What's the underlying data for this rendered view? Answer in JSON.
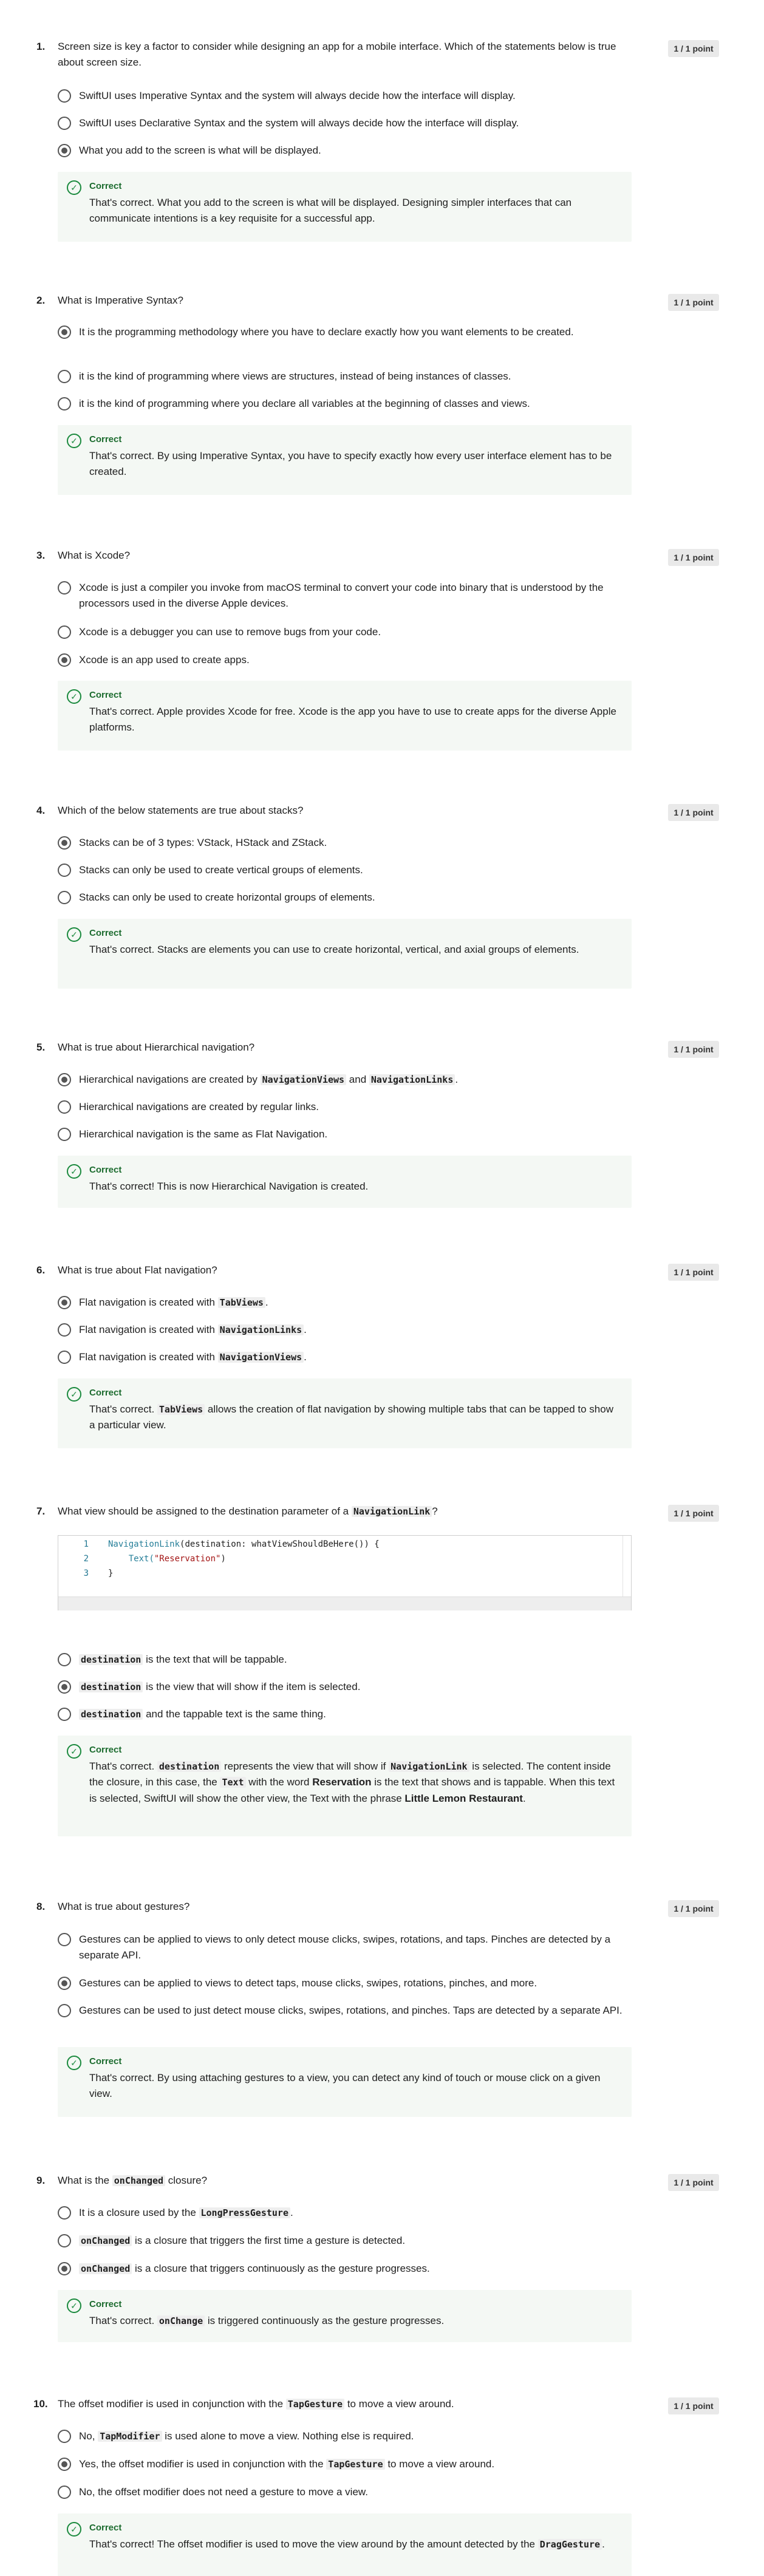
{
  "points_label": "1 / 1 point",
  "correct_label": "Correct",
  "questions": [
    {
      "number": "1.",
      "text": "Screen size is key a factor to consider while designing an app for a mobile interface. Which of the statements below is true about screen size.",
      "options": [
        "SwiftUI uses Imperative Syntax and the system will always decide how the interface will display.",
        "SwiftUI uses Declarative Syntax and the system will always decide how the interface will display.",
        "What you add to the screen is what will be displayed."
      ],
      "feedback": "That's correct. What you add to the screen is what will be displayed. Designing simpler interfaces that can communicate intentions is a key requisite for a successful app."
    },
    {
      "number": "2.",
      "text": "What is Imperative Syntax?",
      "options": [
        "It is the programming methodology where you have to declare exactly how you want elements to be created.",
        "it is the kind of programming where views are structures, instead of being instances of classes.",
        "it is the kind of programming where you declare all variables at the beginning of classes and views."
      ],
      "feedback": "That's correct. By using Imperative Syntax, you have to specify exactly how every user interface element has to be created."
    },
    {
      "number": "3.",
      "text": "What is Xcode?",
      "options": [
        "Xcode is just a compiler you invoke from macOS terminal to convert your code into binary that is understood by the processors used in the diverse Apple devices.",
        "Xcode is a debugger you can use to remove bugs from your code.",
        "Xcode is an app used to create apps."
      ],
      "feedback": "That's correct. Apple provides Xcode for free. Xcode is the app you have to use to create apps for the diverse Apple platforms."
    },
    {
      "number": "4.",
      "text": "Which of the below statements are true about stacks?",
      "options": [
        "Stacks can be of 3 types: VStack, HStack and ZStack.",
        "Stacks can only be used to create vertical groups of elements.",
        "Stacks can only be used to create horizontal groups of elements."
      ],
      "feedback": "That's correct. Stacks are elements you can use to create horizontal, vertical, and axial groups of elements."
    },
    {
      "number": "5.",
      "text": "What is true about Hierarchical navigation?",
      "options": [
        {
          "pre": "Hierarchical navigations are created by ",
          "code1": "NavigationViews",
          "mid": " and ",
          "code2": "NavigationLinks",
          "post": "."
        },
        "Hierarchical navigations are created by regular links.",
        "Hierarchical navigation is the same as Flat Navigation."
      ],
      "feedback": "That's correct! This is now Hierarchical Navigation is created."
    },
    {
      "number": "6.",
      "text": "What is true about Flat navigation?",
      "options": [
        {
          "pre": "Flat navigation is created with ",
          "code": "TabViews",
          "post": "."
        },
        {
          "pre": "Flat navigation is created with ",
          "code": "NavigationLinks",
          "post": "."
        },
        {
          "pre": "Flat navigation is created with ",
          "code": "NavigationViews",
          "post": "."
        }
      ],
      "feedback": {
        "pre": "That's correct. ",
        "code": "TabViews",
        "post": " allows the creation of flat navigation by showing multiple tabs that can be tapped to show a particular view."
      }
    },
    {
      "number": "7.",
      "text": {
        "pre": "What view should be assigned to the destination parameter of a ",
        "code": "NavigationLink",
        "post": "?"
      },
      "code_lines": [
        {
          "num": "1",
          "a": "NavigationLink",
          "b": "(destination: whatViewShouldBeHere()) {"
        },
        {
          "num": "2",
          "a": "    Text(",
          "s": "\"Reservation\"",
          "b": ")"
        },
        {
          "num": "3",
          "a": "}",
          "b": ""
        }
      ],
      "options": [
        {
          "code": "destination",
          "post": " is the text that will be tappable."
        },
        {
          "code": "destination",
          "post": " is the view that will show if the item is selected."
        },
        {
          "code": "destination",
          "post": " and the tappable text is the same thing."
        }
      ],
      "feedback": {
        "p1": "That's correct. ",
        "c1": "destination",
        "p2": " represents the view that will show if ",
        "c2": "NavigationLink",
        "p3": " is selected. The content inside the closure, in this case, the ",
        "c3": "Text",
        "p4": " with the word ",
        "b1": "Reservation",
        "p5": " is the text that shows and is tappable. When this text is selected, SwiftUI will show the other view, the Text with the phrase ",
        "b2": "Little Lemon Restaurant",
        "p6": "."
      }
    },
    {
      "number": "8.",
      "text": "What is true about gestures?",
      "options": [
        "Gestures can be applied to views to only detect mouse clicks, swipes, rotations, and taps. Pinches are detected by a separate API.",
        "Gestures can be applied to views to detect taps, mouse clicks, swipes, rotations, pinches, and more.",
        "Gestures can be used to just detect mouse clicks, swipes, rotations, and pinches. Taps are detected by a separate API."
      ],
      "feedback": "That's correct. By using attaching gestures to a view, you can detect any kind of touch or mouse click on a given view."
    },
    {
      "number": "9.",
      "text": {
        "pre": "What is the ",
        "code": "onChanged",
        "post": " closure?"
      },
      "options": [
        {
          "pre": "It is a closure used by the ",
          "code": "LongPressGesture",
          "post": "."
        },
        {
          "pre": "",
          "code": "onChanged",
          "post": " is a closure that triggers the first time a gesture is detected."
        },
        {
          "pre": "",
          "code": "onChanged",
          "post": " is a closure that triggers continuously as the gesture progresses."
        }
      ],
      "feedback": {
        "pre": "That's correct. ",
        "code": "onChange",
        "post": " is triggered continuously as the gesture progresses."
      }
    },
    {
      "number": "10.",
      "text": {
        "pre": "The offset modifier is used in conjunction with the ",
        "code": "TapGesture",
        "post": " to move a view around."
      },
      "options": [
        {
          "pre": "No, ",
          "code": "TapModifier",
          "post": " is used alone to move a view. Nothing else is required."
        },
        {
          "pre": "Yes, the offset modifier is used in conjunction with the ",
          "code": "TapGesture",
          "post": " to move a view around."
        },
        {
          "pre": "No, the offset modifier does not need a gesture to move a view.",
          "code": "",
          "post": ""
        }
      ],
      "feedback": {
        "pre": "That's correct! The offset modifier is used to move the view around by the amount detected by the ",
        "code": "DragGesture",
        "post": "."
      }
    }
  ]
}
